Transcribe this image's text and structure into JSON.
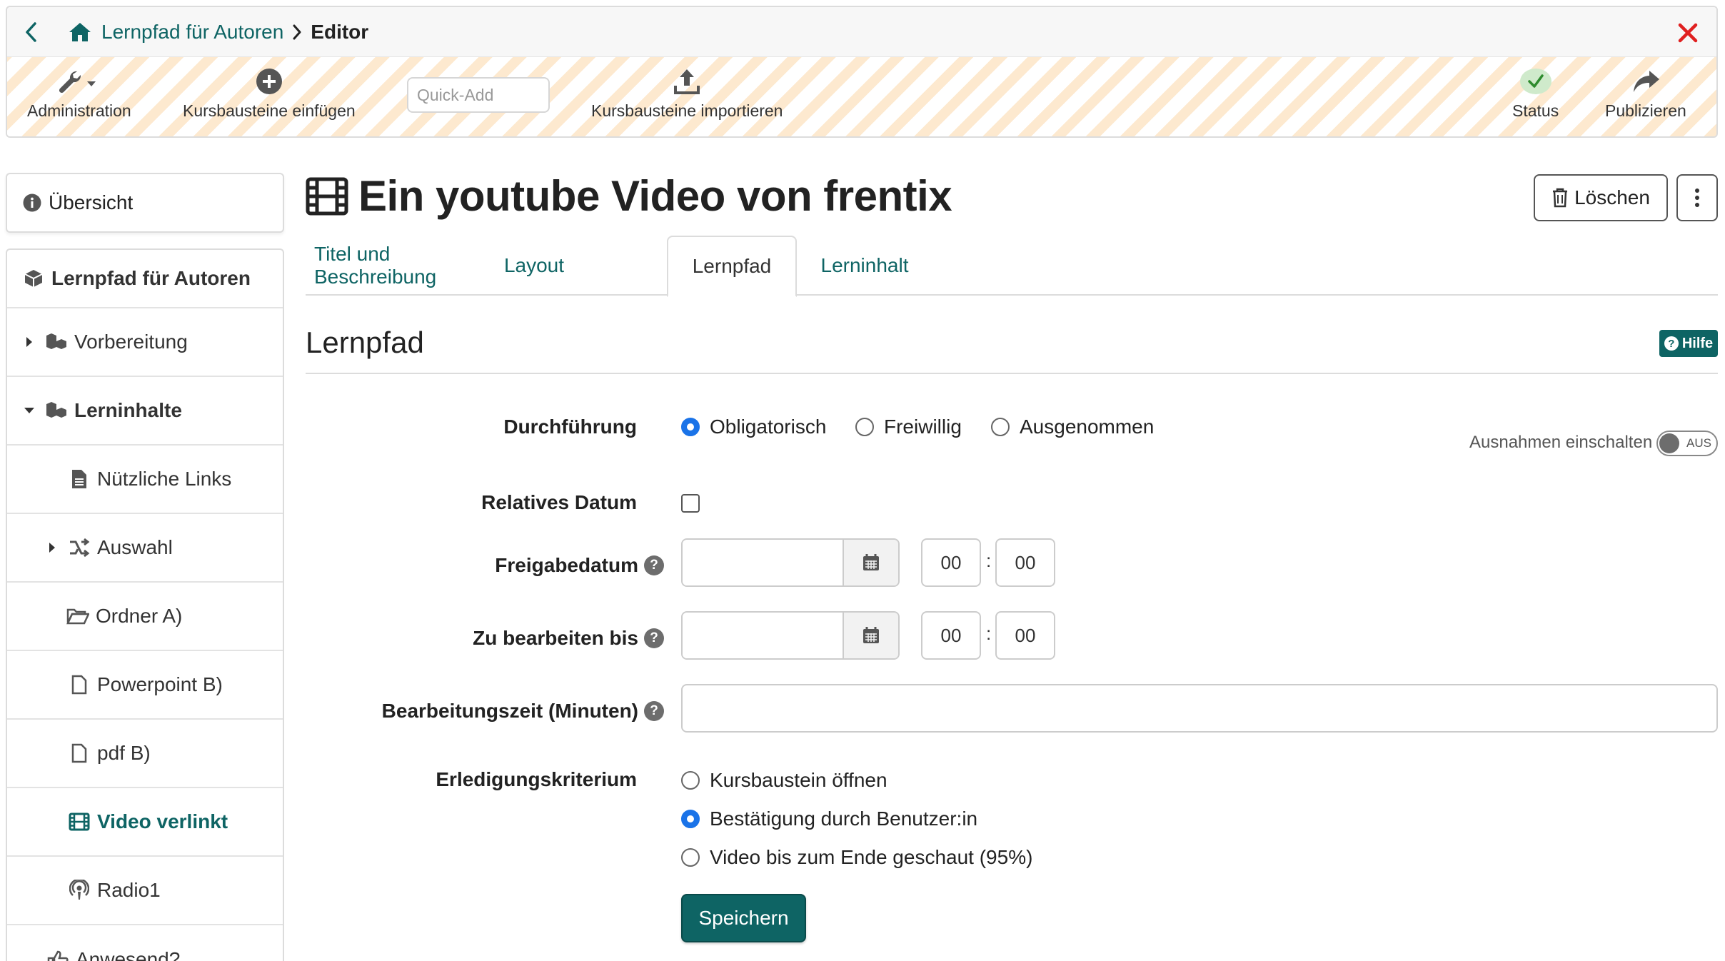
{
  "breadcrumb": {
    "course": "Lernpfad für Autoren",
    "current": "Editor"
  },
  "toolbar": {
    "administration": "Administration",
    "insert": "Kursbausteine einfügen",
    "quick_add_placeholder": "Quick-Add",
    "import": "Kursbausteine importieren",
    "status": "Status",
    "publish": "Publizieren"
  },
  "sidebar": {
    "overview": "Übersicht",
    "tree": [
      {
        "label": "Lernpfad für Autoren",
        "icon": "cube-icon"
      },
      {
        "label": "Vorbereitung",
        "icon": "cubes-icon"
      },
      {
        "label": "Lerninhalte",
        "icon": "cubes-icon"
      },
      {
        "label": "Nützliche Links",
        "icon": "file-text-icon"
      },
      {
        "label": "Auswahl",
        "icon": "shuffle-icon"
      },
      {
        "label": "Ordner A)",
        "icon": "folder-open-icon"
      },
      {
        "label": "Powerpoint B)",
        "icon": "file-icon"
      },
      {
        "label": "pdf B)",
        "icon": "file-icon"
      },
      {
        "label": "Video verlinkt",
        "icon": "film-icon"
      },
      {
        "label": "Radio1",
        "icon": "podcast-icon"
      },
      {
        "label": "Anwesend?",
        "icon": "thumbs-up-icon"
      }
    ]
  },
  "page": {
    "title": "Ein youtube Video von frentix",
    "delete_label": "Löschen"
  },
  "tabs": [
    "Titel und Beschreibung",
    "Layout",
    "Lernpfad",
    "Lerninhalt"
  ],
  "section": {
    "title": "Lernpfad",
    "help_label": "Hilfe"
  },
  "form": {
    "durchfuehrung_label": "Durchführung",
    "durchfuehrung_options": [
      "Obligatorisch",
      "Freiwillig",
      "Ausgenommen"
    ],
    "durchfuehrung_selected": "Obligatorisch",
    "exceptions_label": "Ausnahmen einschalten",
    "exceptions_state": "AUS",
    "relative_date_label": "Relatives Datum",
    "release_date_label": "Freigabedatum",
    "release_hour": "00",
    "release_minute": "00",
    "due_date_label": "Zu bearbeiten bis",
    "due_hour": "00",
    "due_minute": "00",
    "duration_label": "Bearbeitungszeit (Minuten)",
    "criterion_label": "Erledigungskriterium",
    "criterion_options": [
      "Kursbaustein öffnen",
      "Bestätigung durch Benutzer:in",
      "Video bis zum Ende geschaut (95%)"
    ],
    "criterion_selected": "Bestätigung durch Benutzer:in",
    "save_label": "Speichern",
    "time_separator": ":",
    "help_glyph": "?"
  },
  "colors": {
    "brand": "#0e6464",
    "close": "#e02020",
    "status_ok": "#2e8b2e",
    "radio_selected": "#1a73e8"
  }
}
